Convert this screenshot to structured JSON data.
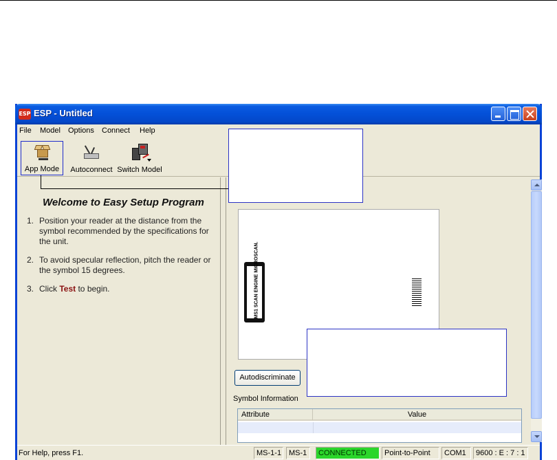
{
  "window": {
    "title": "ESP - Untitled",
    "app_icon_text": "ESP"
  },
  "menu": [
    "File",
    "Model",
    "Options",
    "Connect",
    "Help"
  ],
  "toolbar": {
    "app_mode": "App Mode",
    "autoconnect": "Autoconnect",
    "switch_model": "Switch Model"
  },
  "welcome": {
    "title": "Welcome to Easy Setup Program",
    "steps": [
      {
        "num": "1.",
        "text": "Position your reader at the distance from the symbol recommended by the specifications for the unit."
      },
      {
        "num": "2.",
        "text": "To avoid specular reflection, pitch the reader or the symbol 15 degrees."
      },
      {
        "num": "3.",
        "pre": "Click ",
        "bold": "Test",
        "post": " to begin."
      }
    ]
  },
  "preview": {
    "reader_label": "MS1 SCAN ENGINE MICROSCAN."
  },
  "autodiscriminate_label": "Autodiscriminate",
  "symbol_info": {
    "label": "Symbol Information",
    "columns": [
      "Attribute",
      "Value"
    ]
  },
  "status": {
    "help": "For Help, press F1.",
    "model_full": "MS-1-1",
    "model": "MS-1",
    "connection": "CONNECTED",
    "mode": "Point-to-Point",
    "port": "COM1",
    "settings": "9600 : E : 7 : 1"
  },
  "colors": {
    "connected": "#2bd62b",
    "test_highlight": "#8a1010",
    "callout_border": "#2a31c4"
  }
}
